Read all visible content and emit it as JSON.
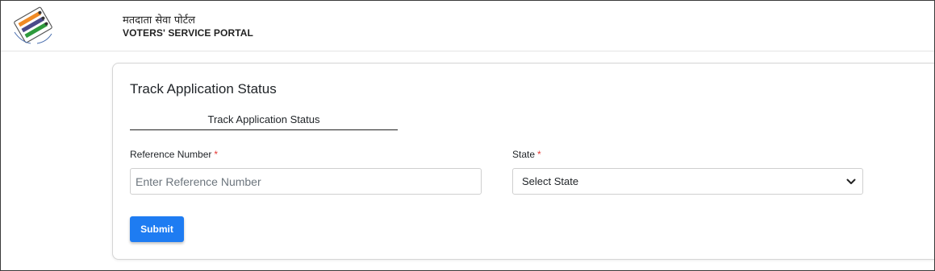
{
  "header": {
    "logo_icon": "election-commission-logo-icon",
    "title_hindi": "मतदाता सेवा पोर्टल",
    "title_english": "VOTERS' SERVICE PORTAL"
  },
  "card": {
    "title": "Track Application Status",
    "tabs": [
      {
        "label": "Track Application Status",
        "active": true
      }
    ],
    "fields": {
      "reference": {
        "label": "Reference Number",
        "required_marker": "*",
        "placeholder": "Enter Reference Number",
        "value": ""
      },
      "state": {
        "label": "State",
        "required_marker": "*",
        "selected": "Select State",
        "icon": "chevron-down-icon"
      }
    },
    "submit_label": "Submit"
  },
  "colors": {
    "accent": "#1e7cf2",
    "required": "#e53935"
  }
}
